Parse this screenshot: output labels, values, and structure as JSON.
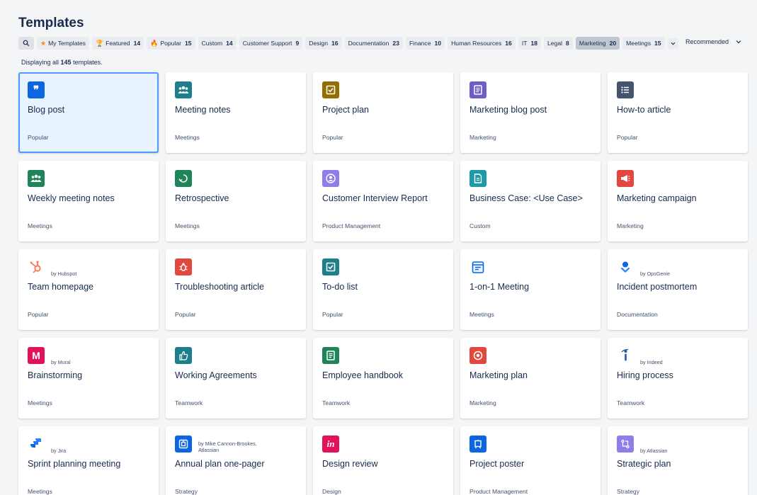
{
  "page": {
    "title": "Templates",
    "count_prefix": "Displaying all",
    "count_value": "145",
    "count_suffix": "templates.",
    "sort_label": "Recommended"
  },
  "filters": [
    {
      "label": "My Templates",
      "count": "",
      "icon": "star-icon",
      "active": false
    },
    {
      "label": "Featured",
      "count": "14",
      "icon": "trophy-icon",
      "active": false
    },
    {
      "label": "Popular",
      "count": "15",
      "icon": "fire-icon",
      "active": false
    },
    {
      "label": "Custom",
      "count": "14",
      "icon": "",
      "active": false
    },
    {
      "label": "Customer Support",
      "count": "9",
      "icon": "",
      "active": false
    },
    {
      "label": "Design",
      "count": "16",
      "icon": "",
      "active": false
    },
    {
      "label": "Documentation",
      "count": "23",
      "icon": "",
      "active": false
    },
    {
      "label": "Finance",
      "count": "10",
      "icon": "",
      "active": false
    },
    {
      "label": "Human Resources",
      "count": "16",
      "icon": "",
      "active": false
    },
    {
      "label": "IT",
      "count": "18",
      "icon": "",
      "active": false
    },
    {
      "label": "Legal",
      "count": "8",
      "icon": "",
      "active": false
    },
    {
      "label": "Marketing",
      "count": "20",
      "icon": "",
      "active": true
    },
    {
      "label": "Meetings",
      "count": "15",
      "icon": "",
      "active": false
    }
  ],
  "templates": [
    {
      "title": "Blog post",
      "category": "Popular",
      "by": "",
      "icon": "quote-icon",
      "color": "#0c66e4",
      "glyph": "❞",
      "selected": true
    },
    {
      "title": "Meeting notes",
      "category": "Meetings",
      "by": "",
      "icon": "people-icon",
      "color": "#1d7f8c",
      "glyph": "people",
      "selected": false
    },
    {
      "title": "Project plan",
      "category": "Popular",
      "by": "",
      "icon": "checkbox-icon",
      "color": "#946f00",
      "glyph": "check",
      "selected": false
    },
    {
      "title": "Marketing blog post",
      "category": "Marketing",
      "by": "",
      "icon": "document-icon",
      "color": "#6e5dc6",
      "glyph": "doc",
      "selected": false
    },
    {
      "title": "How-to article",
      "category": "Popular",
      "by": "",
      "icon": "list-icon",
      "color": "#44546f",
      "glyph": "list",
      "selected": false
    },
    {
      "title": "Weekly meeting notes",
      "category": "Meetings",
      "by": "",
      "icon": "people-icon",
      "color": "#1f845a",
      "glyph": "people",
      "selected": false
    },
    {
      "title": "Retrospective",
      "category": "Meetings",
      "by": "",
      "icon": "refresh-icon",
      "color": "#1f845a",
      "glyph": "retro",
      "selected": false
    },
    {
      "title": "Customer Interview Report",
      "category": "Product Management",
      "by": "",
      "icon": "user-icon",
      "color": "#8f7ee7",
      "glyph": "user",
      "selected": false
    },
    {
      "title": "Business Case: <Use Case>",
      "category": "Custom",
      "by": "",
      "icon": "page-icon",
      "color": "#1d9aaa",
      "glyph": "page",
      "selected": false
    },
    {
      "title": "Marketing campaign",
      "category": "Marketing",
      "by": "",
      "icon": "megaphone-icon",
      "color": "#e2483d",
      "glyph": "megaphone",
      "selected": false
    },
    {
      "title": "Team homepage",
      "category": "Popular",
      "by": "by Hubspot",
      "icon": "hubspot-icon",
      "color": "#ff7a59",
      "glyph": "hubspot",
      "selected": false
    },
    {
      "title": "Troubleshooting article",
      "category": "Popular",
      "by": "",
      "icon": "bug-icon",
      "color": "#e2483d",
      "glyph": "bug",
      "selected": false
    },
    {
      "title": "To-do list",
      "category": "Popular",
      "by": "",
      "icon": "checkbox-icon",
      "color": "#1d7f8c",
      "glyph": "check",
      "selected": false
    },
    {
      "title": "1-on-1 Meeting",
      "category": "Meetings",
      "by": "",
      "icon": "calendar-icon",
      "color": "#0c66e4",
      "glyph": "calendar",
      "selected": false
    },
    {
      "title": "Incident postmortem",
      "category": "Documentation",
      "by": "by OpsGenie",
      "icon": "opsgenie-icon",
      "color": "#0c66e4",
      "glyph": "opsgenie",
      "selected": false
    },
    {
      "title": "Brainstorming",
      "category": "Meetings",
      "by": "by Mural",
      "icon": "mural-icon",
      "color": "#e2115b",
      "glyph": "M",
      "selected": false
    },
    {
      "title": "Working Agreements",
      "category": "Teamwork",
      "by": "",
      "icon": "thumbs-up-icon",
      "color": "#1d7f8c",
      "glyph": "thumb",
      "selected": false
    },
    {
      "title": "Employee handbook",
      "category": "Teamwork",
      "by": "",
      "icon": "book-icon",
      "color": "#1f845a",
      "glyph": "doc",
      "selected": false
    },
    {
      "title": "Marketing plan",
      "category": "Marketing",
      "by": "",
      "icon": "target-icon",
      "color": "#e2483d",
      "glyph": "target",
      "selected": false
    },
    {
      "title": "Hiring process",
      "category": "Teamwork",
      "by": "by Indeed",
      "icon": "indeed-icon",
      "color": "#2557a7",
      "glyph": "indeed",
      "selected": false
    },
    {
      "title": "Sprint planning meeting",
      "category": "Meetings",
      "by": "by Jira",
      "icon": "jira-icon",
      "color": "#0c66e4",
      "glyph": "jira",
      "selected": false
    },
    {
      "title": "Annual plan one-pager",
      "category": "Strategy",
      "by": "by Mike Cannon-Brookes, Atlassian",
      "icon": "plan-icon",
      "color": "#0c66e4",
      "glyph": "plan",
      "selected": false
    },
    {
      "title": "Design review",
      "category": "Design",
      "by": "",
      "icon": "invision-icon",
      "color": "#e2115b",
      "glyph": "in",
      "selected": false
    },
    {
      "title": "Project poster",
      "category": "Product Management",
      "by": "",
      "icon": "poster-icon",
      "color": "#0c66e4",
      "glyph": "poster",
      "selected": false
    },
    {
      "title": "Strategic plan",
      "category": "Strategy",
      "by": "by Atlassian",
      "icon": "flow-icon",
      "color": "#8f7ee7",
      "glyph": "flow",
      "selected": false
    }
  ]
}
